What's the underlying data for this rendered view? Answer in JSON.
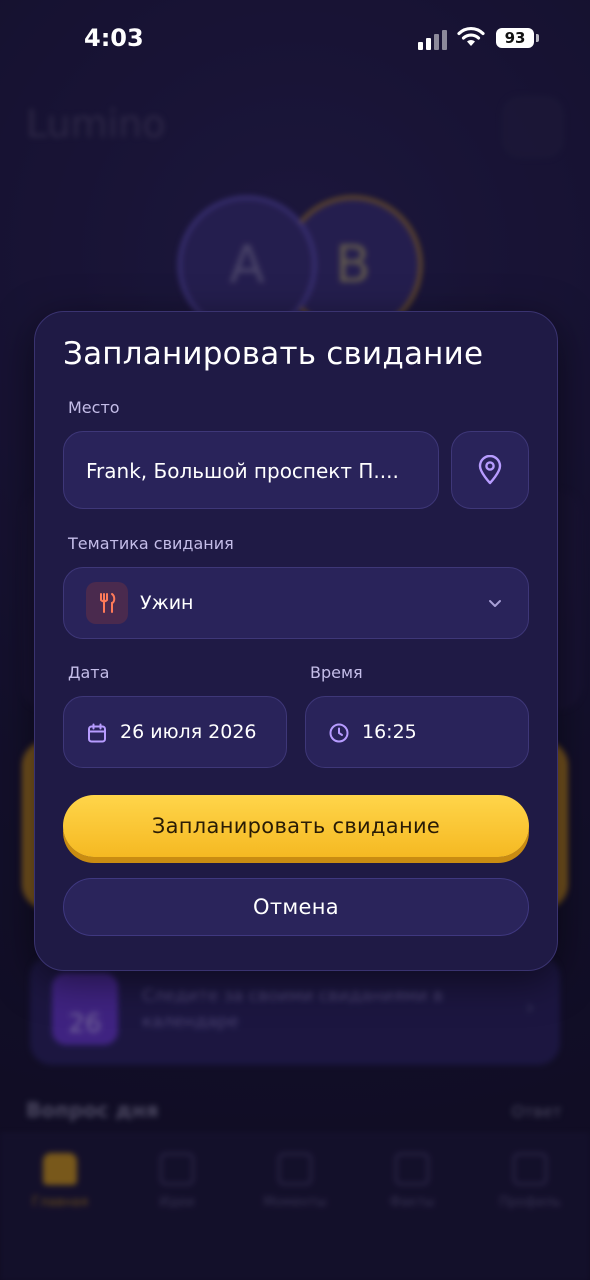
{
  "status_bar": {
    "time": "4:03",
    "battery": "93"
  },
  "background": {
    "app_title": "Lumino",
    "avatar_a": "A",
    "avatar_b": "B",
    "streak_day": "26",
    "streak_text": "Следите за своими свиданиями в календаре",
    "question_title": "Вопрос дня",
    "question_link": "Ответ",
    "tabs": [
      "Главная",
      "Идеи",
      "Моменты",
      "Факты",
      "Профиль"
    ]
  },
  "modal": {
    "title": "Запланировать свидание",
    "place_label": "Место",
    "place_value": "Frank, Большой проспект П....",
    "theme_label": "Тематика свидания",
    "theme_value": "Ужин",
    "date_label": "Дата",
    "date_value": "26 июля 2026",
    "time_label": "Время",
    "time_value": "16:25",
    "submit_label": "Запланировать свидание",
    "cancel_label": "Отмена"
  },
  "colors": {
    "accent": "#f5b922",
    "modal_bg": "#1f1a45",
    "field_bg": "#29235a",
    "icon_purple": "#b79cff"
  }
}
